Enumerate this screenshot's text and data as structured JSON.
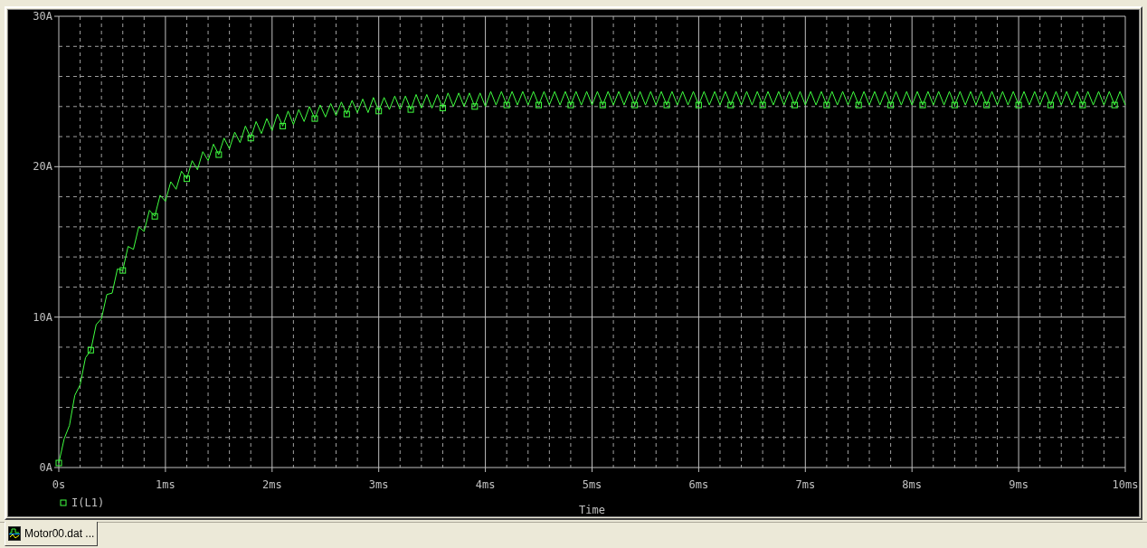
{
  "plot": {
    "chart_data": {
      "type": "line",
      "xlabel": "Time",
      "grid": true,
      "xlim": [
        0,
        10
      ],
      "ylim": [
        0,
        30
      ],
      "xticks": [
        {
          "value": 0,
          "label": "0s"
        },
        {
          "value": 1,
          "label": "1ms"
        },
        {
          "value": 2,
          "label": "2ms"
        },
        {
          "value": 3,
          "label": "3ms"
        },
        {
          "value": 4,
          "label": "4ms"
        },
        {
          "value": 5,
          "label": "5ms"
        },
        {
          "value": 6,
          "label": "6ms"
        },
        {
          "value": 7,
          "label": "7ms"
        },
        {
          "value": 8,
          "label": "8ms"
        },
        {
          "value": 9,
          "label": "9ms"
        },
        {
          "value": 10,
          "label": "10ms"
        }
      ],
      "yticks": [
        {
          "value": 0,
          "label": "0A"
        },
        {
          "value": 10,
          "label": "10A"
        },
        {
          "value": 20,
          "label": "20A"
        },
        {
          "value": 30,
          "label": "30A"
        }
      ],
      "x": [
        0,
        0.05,
        0.1,
        0.15,
        0.2,
        0.25,
        0.3,
        0.35,
        0.4,
        0.45,
        0.5,
        0.55,
        0.6,
        0.65,
        0.7,
        0.75,
        0.8,
        0.85,
        0.9,
        0.95,
        1,
        1.05,
        1.1,
        1.15,
        1.2,
        1.25,
        1.3,
        1.35,
        1.4,
        1.45,
        1.5,
        1.55,
        1.6,
        1.65,
        1.7,
        1.75,
        1.8,
        1.85,
        1.9,
        1.95,
        2,
        2.05,
        2.1,
        2.15,
        2.2,
        2.25,
        2.3,
        2.35,
        2.4,
        2.45,
        2.5,
        2.55,
        2.6,
        2.65,
        2.7,
        2.75,
        2.8,
        2.85,
        2.9,
        2.95,
        3,
        3.05,
        3.1,
        3.15,
        3.2,
        3.25,
        3.3,
        3.35,
        3.4,
        3.45,
        3.5,
        3.55,
        3.6,
        3.65,
        3.7,
        3.75,
        3.8,
        3.85,
        3.9,
        3.95,
        4,
        4.05,
        4.1,
        4.15,
        4.2,
        4.25,
        4.3,
        4.35,
        4.4,
        4.45,
        4.5,
        4.55,
        4.6,
        4.65,
        4.7,
        4.75,
        4.8,
        4.85,
        4.9,
        4.95,
        5,
        5.05,
        5.1,
        5.15,
        5.2,
        5.25,
        5.3,
        5.35,
        5.4,
        5.45,
        5.5,
        5.55,
        5.6,
        5.65,
        5.7,
        5.75,
        5.8,
        5.85,
        5.9,
        5.95,
        6,
        6.05,
        6.1,
        6.15,
        6.2,
        6.25,
        6.3,
        6.35,
        6.4,
        6.45,
        6.5,
        6.55,
        6.6,
        6.65,
        6.7,
        6.75,
        6.8,
        6.85,
        6.9,
        6.95,
        7,
        7.05,
        7.1,
        7.15,
        7.2,
        7.25,
        7.3,
        7.35,
        7.4,
        7.45,
        7.5,
        7.55,
        7.6,
        7.65,
        7.7,
        7.75,
        7.8,
        7.85,
        7.9,
        7.95,
        8,
        8.05,
        8.1,
        8.15,
        8.2,
        8.25,
        8.3,
        8.35,
        8.4,
        8.45,
        8.5,
        8.55,
        8.6,
        8.65,
        8.7,
        8.75,
        8.8,
        8.85,
        8.9,
        8.95,
        9,
        9.05,
        9.1,
        9.15,
        9.2,
        9.25,
        9.3,
        9.35,
        9.4,
        9.45,
        9.5,
        9.55,
        9.6,
        9.65,
        9.7,
        9.75,
        9.8,
        9.85,
        9.9,
        9.95,
        10
      ],
      "series": [
        {
          "name": "I(L1)",
          "color": "#40ff40",
          "values": [
            0.3,
            1.9,
            2.8,
            4.8,
            5.5,
            7.3,
            7.8,
            9.5,
            9.9,
            11.5,
            11.6,
            13.2,
            13.1,
            14.7,
            14.5,
            16.0,
            15.7,
            17.1,
            16.7,
            18.1,
            17.7,
            19.0,
            18.5,
            19.7,
            19.2,
            20.4,
            19.8,
            21.0,
            20.4,
            21.5,
            20.8,
            21.9,
            21.2,
            22.3,
            21.6,
            22.7,
            21.9,
            23.0,
            22.2,
            23.2,
            22.4,
            23.5,
            22.7,
            23.7,
            22.8,
            23.8,
            23.0,
            24.0,
            23.2,
            24.1,
            23.3,
            24.2,
            23.4,
            24.3,
            23.5,
            24.4,
            23.6,
            24.5,
            23.6,
            24.6,
            23.7,
            24.6,
            23.8,
            24.7,
            23.8,
            24.7,
            23.8,
            24.8,
            23.9,
            24.8,
            23.9,
            24.8,
            23.9,
            24.9,
            24.0,
            24.9,
            24.0,
            24.9,
            24.0,
            24.9,
            24.0,
            25.0,
            24.1,
            25.0,
            24.1,
            25.0,
            24.1,
            25.0,
            24.1,
            25.0,
            24.1,
            25.0,
            24.1,
            25.0,
            24.1,
            25.0,
            24.1,
            25.0,
            24.1,
            25.0,
            24.1,
            25.0,
            24.1,
            25.0,
            24.1,
            25.0,
            24.1,
            25.0,
            24.1,
            25.0,
            24.1,
            25.0,
            24.1,
            25.0,
            24.1,
            25.0,
            24.1,
            25.0,
            24.1,
            25.0,
            24.1,
            25.0,
            24.1,
            25.0,
            24.1,
            25.0,
            24.1,
            25.0,
            24.1,
            25.0,
            24.1,
            25.0,
            24.1,
            25.0,
            24.1,
            25.0,
            24.1,
            25.0,
            24.1,
            25.0,
            24.1,
            25.0,
            24.1,
            25.0,
            24.1,
            25.0,
            24.1,
            25.0,
            24.1,
            25.0,
            24.1,
            25.0,
            24.1,
            25.0,
            24.1,
            25.0,
            24.1,
            25.0,
            24.1,
            25.0,
            24.1,
            25.0,
            24.1,
            25.0,
            24.1,
            25.0,
            24.1,
            25.0,
            24.1,
            25.0,
            24.1,
            25.0,
            24.1,
            25.0,
            24.1,
            25.0,
            24.1,
            25.0,
            24.1,
            25.0,
            24.1,
            25.0,
            24.1,
            25.0,
            24.1,
            25.0,
            24.1,
            25.0,
            24.1,
            25.0,
            24.1,
            25.0,
            24.1,
            25.0,
            24.1,
            25.0,
            24.1,
            25.0,
            24.1,
            25.0,
            24.1
          ]
        }
      ]
    }
  },
  "tabs": [
    {
      "label": "Motor00.dat ...",
      "selected": true
    }
  ]
}
